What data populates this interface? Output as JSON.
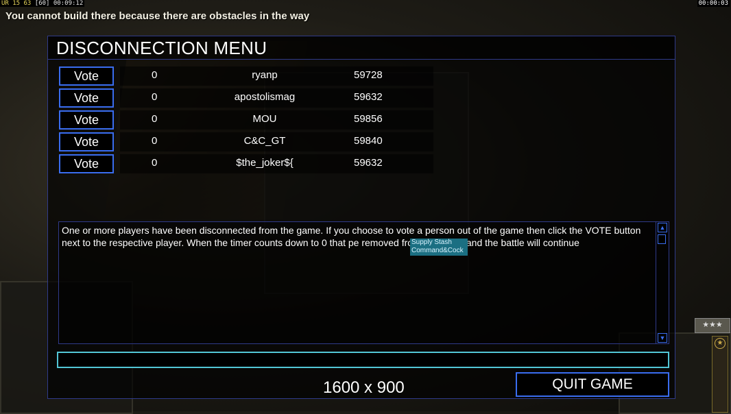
{
  "hud": {
    "stats_prefix": "UR 15 63",
    "stats_fps": "[60]",
    "stats_time": "00:09:12",
    "clock": "00:00:03",
    "message": "You cannot build there because there are obstacles in the way"
  },
  "dialog": {
    "title": "DISCONNECTION MENU",
    "players": [
      {
        "vote_label": "Vote",
        "votes": "0",
        "name": "ryanp",
        "ping": "59728"
      },
      {
        "vote_label": "Vote",
        "votes": "0",
        "name": "apostolismag",
        "ping": "59632"
      },
      {
        "vote_label": "Vote",
        "votes": "0",
        "name": "MOU",
        "ping": "59856"
      },
      {
        "vote_label": "Vote",
        "votes": "0",
        "name": "C&C_GT",
        "ping": "59840"
      },
      {
        "vote_label": "Vote",
        "votes": "0",
        "name": "$the_joker${",
        "ping": "59632"
      }
    ],
    "message": "One or more players have been disconnected from the game. If you choose to vote a person out of the game then click the VOTE button next to the respective player. When the timer counts down to 0 that pe            removed from the game and the battle will continue",
    "tooltip_line1": "Supply Stash",
    "tooltip_line2": "Command&Cock",
    "chat_value": "",
    "resolution": "1600 x 900",
    "quit_label": "QUIT GAME"
  },
  "rank": {
    "stars": "★★★"
  },
  "icons": {
    "scroll_up": "scroll-up-icon",
    "scroll_down": "scroll-down-icon",
    "rank_star": "star-icon"
  }
}
